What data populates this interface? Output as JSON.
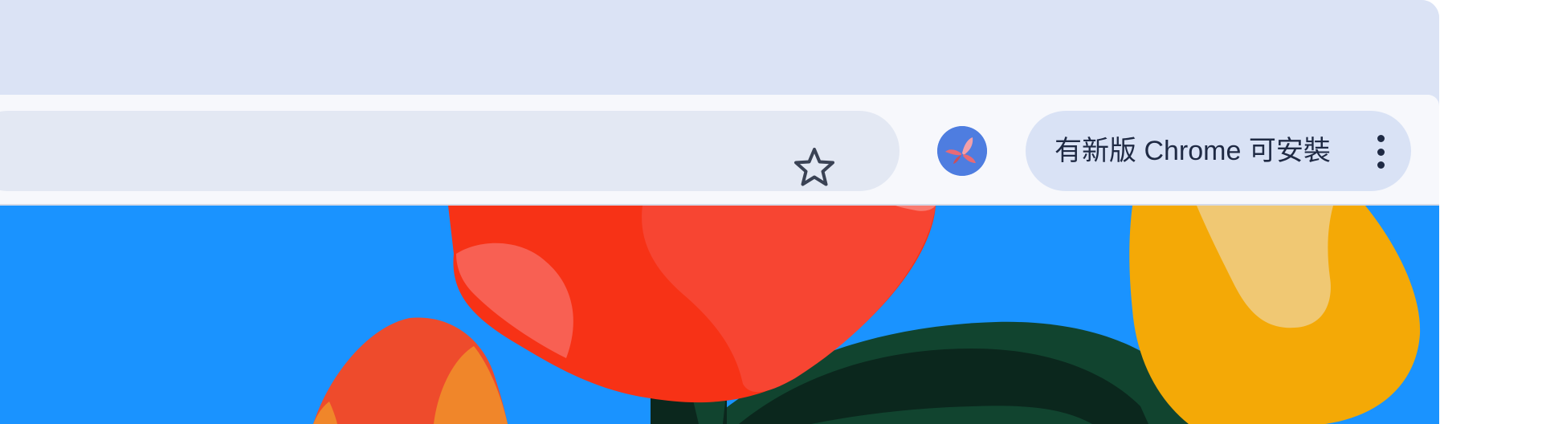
{
  "toolbar": {
    "bookmark_icon": "star-outline-icon",
    "profile_icon": "butterfly-avatar-icon",
    "update_button_label": "有新版 Chrome 可安裝",
    "menu_icon": "vertical-dots-icon"
  },
  "colors": {
    "tabstrip_bg": "#dbe3f5",
    "toolbar_bg": "#f7f8fc",
    "omnibox_bg": "#e3e8f3",
    "chip_bg": "#d9e2f5",
    "avatar_bg": "#4e7de0",
    "content_bg": "#1a93ff"
  },
  "content": {
    "illustration": "floral-wallpaper"
  }
}
